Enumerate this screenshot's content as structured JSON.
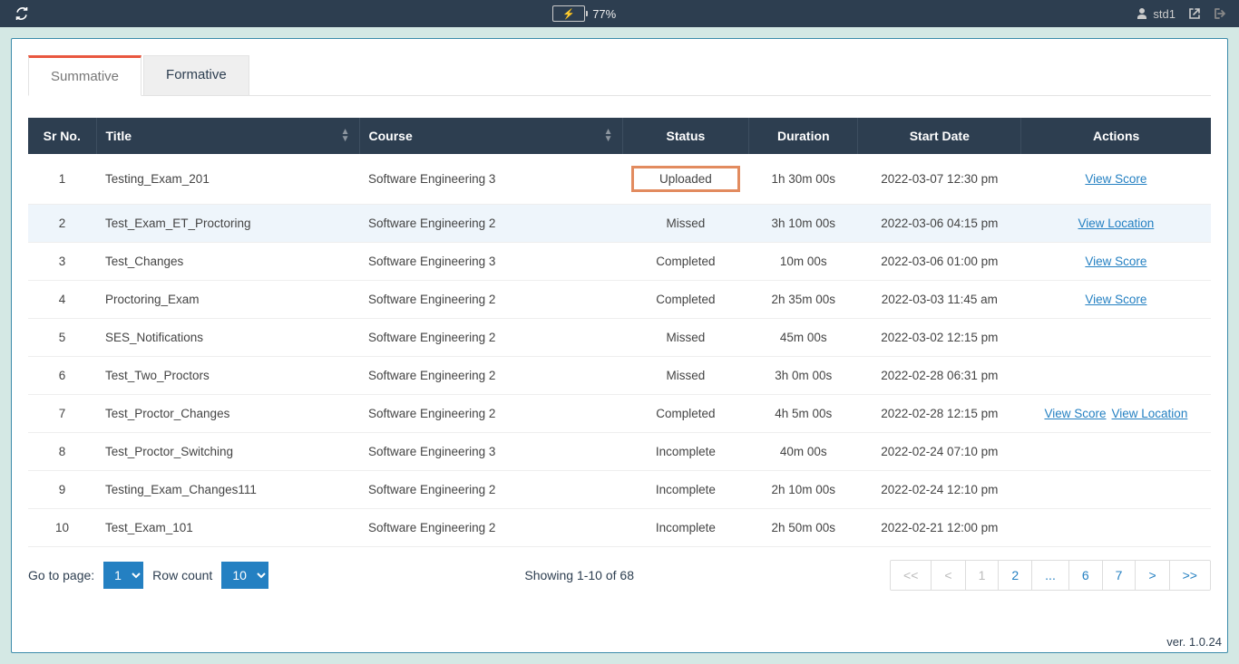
{
  "topbar": {
    "battery": "77%",
    "username": "std1"
  },
  "tabs": {
    "summative": "Summative",
    "formative": "Formative"
  },
  "columns": {
    "sr": "Sr No.",
    "title": "Title",
    "course": "Course",
    "status": "Status",
    "duration": "Duration",
    "start": "Start Date",
    "actions": "Actions"
  },
  "rows": [
    {
      "sr": "1",
      "title": "Testing_Exam_201",
      "course": "Software Engineering 3",
      "status": "Uploaded",
      "status_hl": true,
      "duration": "1h 30m 00s",
      "start": "2022-03-07 12:30 pm",
      "actions": [
        "View Score"
      ]
    },
    {
      "sr": "2",
      "title": "Test_Exam_ET_Proctoring",
      "course": "Software Engineering 2",
      "status": "Missed",
      "duration": "3h 10m 00s",
      "start": "2022-03-06 04:15 pm",
      "actions": [
        "View Location"
      ],
      "row_hl": true
    },
    {
      "sr": "3",
      "title": "Test_Changes",
      "course": "Software Engineering 3",
      "status": "Completed",
      "duration": "10m 00s",
      "start": "2022-03-06 01:00 pm",
      "actions": [
        "View Score"
      ]
    },
    {
      "sr": "4",
      "title": "Proctoring_Exam",
      "course": "Software Engineering 2",
      "status": "Completed",
      "duration": "2h 35m 00s",
      "start": "2022-03-03 11:45 am",
      "actions": [
        "View Score"
      ]
    },
    {
      "sr": "5",
      "title": "SES_Notifications",
      "course": "Software Engineering 2",
      "status": "Missed",
      "duration": "45m 00s",
      "start": "2022-03-02 12:15 pm",
      "actions": []
    },
    {
      "sr": "6",
      "title": "Test_Two_Proctors",
      "course": "Software Engineering 2",
      "status": "Missed",
      "duration": "3h 0m 00s",
      "start": "2022-02-28 06:31 pm",
      "actions": []
    },
    {
      "sr": "7",
      "title": "Test_Proctor_Changes",
      "course": "Software Engineering 2",
      "status": "Completed",
      "duration": "4h 5m 00s",
      "start": "2022-02-28 12:15 pm",
      "actions": [
        "View Score",
        "View Location"
      ]
    },
    {
      "sr": "8",
      "title": "Test_Proctor_Switching",
      "course": "Software Engineering 3",
      "status": "Incomplete",
      "duration": "40m 00s",
      "start": "2022-02-24 07:10 pm",
      "actions": []
    },
    {
      "sr": "9",
      "title": "Testing_Exam_Changes111",
      "course": "Software Engineering 2",
      "status": "Incomplete",
      "duration": "2h 10m 00s",
      "start": "2022-02-24 12:10 pm",
      "actions": []
    },
    {
      "sr": "10",
      "title": "Test_Exam_101",
      "course": "Software Engineering 2",
      "status": "Incomplete",
      "duration": "2h 50m 00s",
      "start": "2022-02-21 12:00 pm",
      "actions": []
    }
  ],
  "footer": {
    "goto_label": "Go to page:",
    "goto_value": "1",
    "rowcount_label": "Row count",
    "rowcount_value": "10",
    "showing": "Showing 1-10 of 68",
    "pages": [
      {
        "label": "<<",
        "disabled": true
      },
      {
        "label": "<",
        "disabled": true
      },
      {
        "label": "1",
        "current": true
      },
      {
        "label": "2"
      },
      {
        "label": "..."
      },
      {
        "label": "6"
      },
      {
        "label": "7"
      },
      {
        "label": ">"
      },
      {
        "label": ">>"
      }
    ]
  },
  "version": "ver. 1.0.24"
}
